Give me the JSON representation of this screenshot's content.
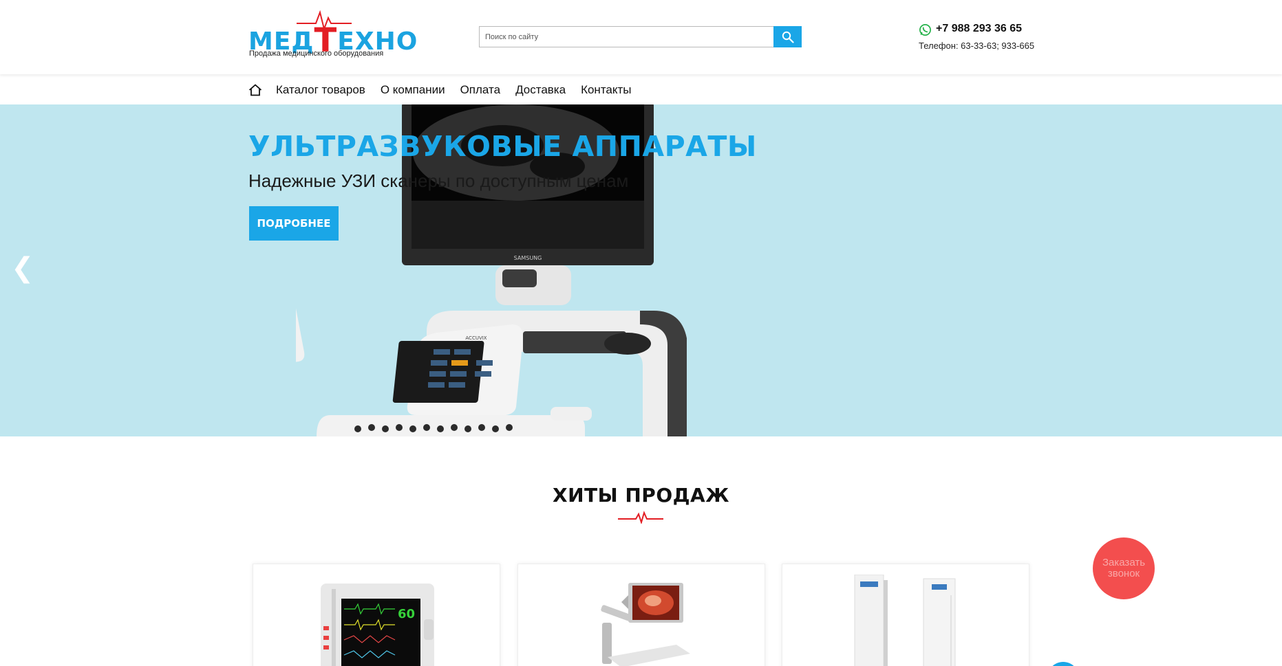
{
  "brand": {
    "logo_prefix": "МЕД",
    "logo_t": "Т",
    "logo_suffix": "ЕХНО",
    "tagline": "Продажа медицинского оборудования",
    "blue": "#1ba3e0",
    "red": "#e31e24"
  },
  "search": {
    "placeholder": "Поиск по сайту",
    "icon": "search-icon"
  },
  "contacts": {
    "whatsapp_icon": "whatsapp-icon",
    "phone": "+7 988 293 36 65",
    "phones_line": "Телефон: 63-33-63; 933-665"
  },
  "nav": {
    "home_icon": "home-icon",
    "items": [
      {
        "label": "Каталог товаров"
      },
      {
        "label": "О компании"
      },
      {
        "label": "Оплата"
      },
      {
        "label": "Доставка"
      },
      {
        "label": "Контакты"
      }
    ]
  },
  "hero": {
    "title": "УЛЬТРАЗВУКОВЫЕ АППАРАТЫ",
    "subtitle": "Надежные УЗИ сканеры по доступным ценам",
    "button": "ПОДРОБНЕЕ",
    "prev_arrow": "❮",
    "monitor_brand": "SAMSUNG",
    "panel_brand": "ACCUVIX",
    "background": "#bfe6ef"
  },
  "hits": {
    "title": "ХИТЫ ПРОДАЖ",
    "monitor_reading": "60"
  },
  "callback": {
    "label": "Заказать звонок",
    "color": "#f34e4e"
  }
}
